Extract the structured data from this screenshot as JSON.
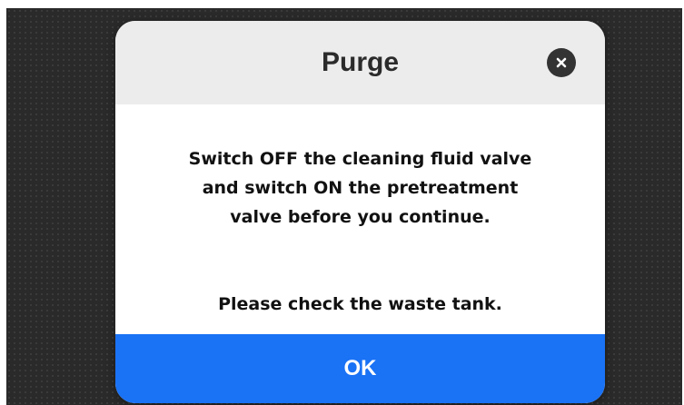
{
  "dialog": {
    "title": "Purge",
    "close_icon": "close-icon",
    "message_lines": [
      "Switch OFF the cleaning fluid valve",
      "and switch ON the pretreatment",
      "valve before you continue."
    ],
    "note": "Please check the waste tank.",
    "ok_label": "OK"
  },
  "colors": {
    "backdrop": "#2a2a2a",
    "header": "#ececec",
    "ok_button": "#1a72f5",
    "close_button": "#333333"
  }
}
